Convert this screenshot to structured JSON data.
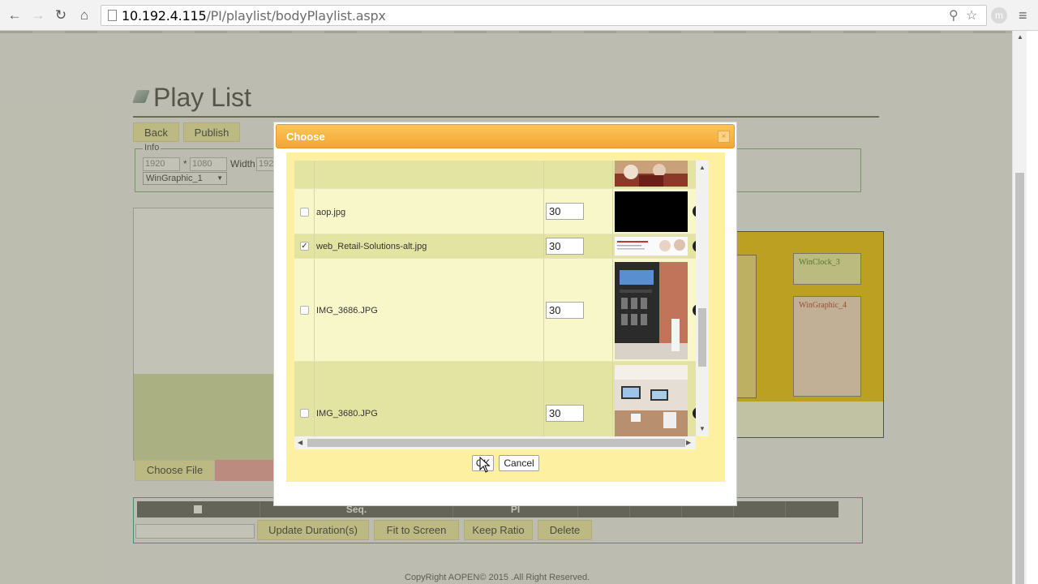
{
  "browser": {
    "url_host": "10.192.4.115",
    "url_path": "/PI/playlist/bodyPlaylist.aspx",
    "back_icon": "arrow-left",
    "forward_icon": "arrow-right",
    "reload_icon": "reload",
    "home_icon": "home",
    "user_initial": "m"
  },
  "page": {
    "title": "Play List",
    "back_label": "Back",
    "publish_label": "Publish",
    "info_legend": "Info",
    "width_value": "1920",
    "height_value": "1080",
    "multiply_sign": "*",
    "width_label": "Width",
    "width_input_value": "192",
    "zone_select": "WinGraphic_1",
    "choose_file_label": "Choose File",
    "zones": {
      "clock": "WinClock_3",
      "graphic": "WinGraphic_4"
    },
    "table": {
      "headers": [
        "",
        "Seq.",
        "PI",
        "",
        "",
        "",
        ""
      ]
    },
    "actions": {
      "update": "Update Duration(s)",
      "fit": "Fit to Screen",
      "keep": "Keep Ratio",
      "delete": "Delete"
    },
    "copyright": "CopyRight AOPEN© 2015 .All Right Reserved."
  },
  "dialog": {
    "title": "Choose",
    "close_symbol": "×",
    "rows": [
      {
        "checked": false,
        "name": "",
        "duration": "",
        "thumb": "partial",
        "has_check": false
      },
      {
        "checked": false,
        "name": "aop.jpg",
        "duration": "30",
        "thumb": "black"
      },
      {
        "checked": true,
        "name": "web_Retail-Solutions-alt.jpg",
        "duration": "30",
        "thumb": "banner"
      },
      {
        "checked": false,
        "name": "IMG_3686.JPG",
        "duration": "30",
        "thumb": "store"
      },
      {
        "checked": false,
        "name": "IMG_3680.JPG",
        "duration": "30",
        "thumb": "booth"
      }
    ],
    "ok_label": "OK",
    "cancel_label": "Cancel"
  },
  "colors": {
    "dialog_title": "#f5a632",
    "dialog_content": "#fdf0a0",
    "row_odd": "#f7f7c9",
    "row_even": "#e3e4a1",
    "button_yellow": "#f5f0a8"
  }
}
